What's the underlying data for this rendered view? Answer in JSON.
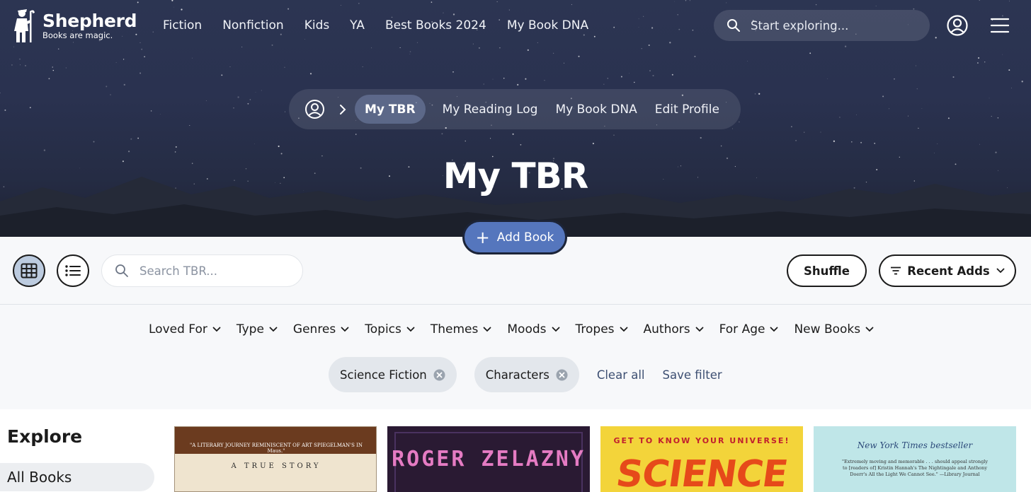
{
  "brand": {
    "name": "Shepherd",
    "tagline": "Books are magic."
  },
  "topnav": [
    "Fiction",
    "Nonfiction",
    "Kids",
    "YA",
    "Best Books 2024",
    "My Book DNA"
  ],
  "search": {
    "placeholder": "Start exploring..."
  },
  "subnav": {
    "active": "My TBR",
    "links": [
      "My Reading Log",
      "My Book DNA",
      "Edit Profile"
    ]
  },
  "page_title": "My TBR",
  "add_book_label": "Add Book",
  "toolbar": {
    "search_placeholder": "Search TBR...",
    "shuffle_label": "Shuffle",
    "sort_label": "Recent Adds"
  },
  "filters": [
    "Loved For",
    "Type",
    "Genres",
    "Topics",
    "Themes",
    "Moods",
    "Tropes",
    "Authors",
    "For Age",
    "New Books"
  ],
  "active_chips": [
    "Science Fiction",
    "Characters"
  ],
  "filter_actions": {
    "clear": "Clear all",
    "save": "Save filter"
  },
  "sidebar": {
    "heading": "Explore",
    "selected": "All Books"
  },
  "books": {
    "b1": {
      "quote": "\"A LITERARY JOURNEY REMINISCENT OF ART SPIEGELMAN'S IN Maus.\"",
      "sub": "A TRUE STORY"
    },
    "b2": {
      "title": "ROGER ZELAZNY"
    },
    "b3": {
      "tag": "GET TO KNOW YOUR UNIVERSE!",
      "title": "SCIENCE"
    },
    "b4": {
      "tag": "New York Times bestseller",
      "blurb": "\"Extremely moving and memorable . . . should appeal strongly to [readers of] Kristin Hannah's The Nightingale and Anthony Doerr's All the Light We Cannot See.\" —Library Journal"
    }
  },
  "colors": {
    "accent": "#5576bd",
    "hero_bg": "#2a3250",
    "chip_bg": "#e3e7ec",
    "link": "#3d4f72"
  }
}
